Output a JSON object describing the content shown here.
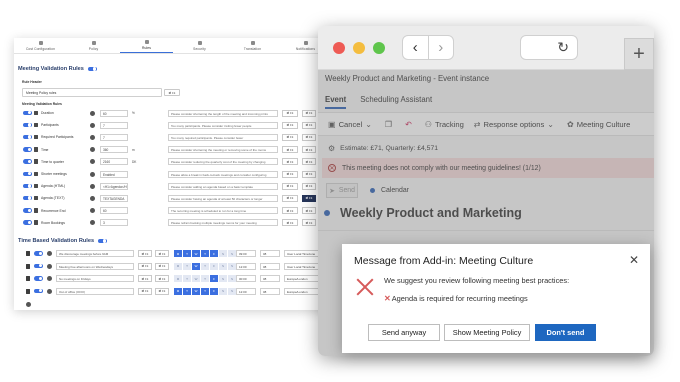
{
  "admin": {
    "nav_tabs": [
      "Cost Configuration",
      "Policy",
      "Rules",
      "Security",
      "Translation",
      "Notifications"
    ],
    "rules_section_title": "Meeting Validation Rules",
    "rule_header_label": "Rule Header",
    "rule_name_value": "Meeting Policy rules",
    "rules_header_btn": "⇄ Fit",
    "meeting_rules_label": "Meeting Validation Rules",
    "rules": [
      {
        "name": "Duration",
        "value": "60",
        "unit": "%",
        "message": "Please consider shortening the length of the meeting and incoming prints",
        "btn1": "⇄ Fit",
        "btn2": "⇄ Fit"
      },
      {
        "name": "Participants",
        "value": "7",
        "unit": "",
        "message": "Too many participants. Please consider inviting fewer people",
        "btn1": "⇄ Fit",
        "btn2": "⇄ Fit"
      },
      {
        "name": "Required Participants",
        "value": "7",
        "unit": "",
        "message": "Too many required participants. Please consider fewer",
        "btn1": "⇄ Fit",
        "btn2": "⇄ Fit"
      },
      {
        "name": "Time",
        "value": "360",
        "unit": "m",
        "message": "Please consider shortening the meeting or removing some of the rooms",
        "btn1": "⇄ Fit",
        "btn2": "⇄ Fit"
      },
      {
        "name": "Time to quarter",
        "value": "2160",
        "unit": "DK",
        "message": "Please consider reducing the quarterly cost of the meeting by changing",
        "btn1": "⇄ Fit",
        "btn2": "⇄ Fit"
      },
      {
        "name": "Shorter meetings",
        "value": "Enabled",
        "unit": "",
        "message": "Please allow a break in back-to-back meetings and consider configuring",
        "btn1": "⇄ Fit",
        "btn2": "⇄ Fit"
      },
      {
        "name": "Agenda (HTML)",
        "value": "<H1>Agenda</H1><p>Wh",
        "unit": "",
        "message": "Please consider adding an agenda based on a basic template",
        "btn1": "⇄ Fit",
        "btn2": "⇄ Fit"
      },
      {
        "name": "Agenda (TEXT)",
        "value": "TEXTAGENDA",
        "unit": "",
        "message": "Please consider having an agenda of at least 50 characters or longer",
        "btn1": "⇄ Fit",
        "btn2": "⇄ Fit",
        "dark": true
      },
      {
        "name": "Recurrence End",
        "value": "60",
        "unit": "",
        "message": "The recurring meeting is scheduled to run for a long time",
        "btn1": "⇄ Fit",
        "btn2": "⇄ Fit"
      },
      {
        "name": "Room Bookings",
        "value": "3",
        "unit": "",
        "message": "Please refrain booking multiple meetings rooms for your meeting",
        "btn1": "⇄ Fit",
        "btn2": "⇄ Fit"
      }
    ],
    "time_section_title": "Time Based Validation Rules",
    "time_rules": [
      {
        "message": "We discourage meetings before 9AM",
        "days": [
          true,
          true,
          true,
          true,
          true,
          false,
          false
        ],
        "from": "09:00",
        "to": "08",
        "tz": "User Local Timezone"
      },
      {
        "message": "Meeting free afternoons on Wednesdays",
        "days": [
          false,
          false,
          true,
          false,
          false,
          false,
          false
        ],
        "from": "12:00",
        "to": "08",
        "tz": "User Local Timezone"
      },
      {
        "message": "No meetings on Fridays",
        "days": [
          false,
          false,
          false,
          false,
          true,
          false,
          false
        ],
        "from": "00:00",
        "to": "08",
        "tz": "Europe/London"
      },
      {
        "message": "Out of office (OOO)",
        "days": [
          true,
          true,
          true,
          true,
          true,
          false,
          false
        ],
        "from": "12:00",
        "to": "08",
        "tz": "Europe/London"
      }
    ],
    "day_letters": [
      "M",
      "T",
      "W",
      "T",
      "F",
      "S",
      "S"
    ],
    "time_btn": "⇄ Fit"
  },
  "outlook": {
    "event_title": "Weekly Product and Marketing - Event instance",
    "tabs": [
      "Event",
      "Scheduling Assistant"
    ],
    "toolbar": {
      "cancel": "Cancel",
      "tracking": "Tracking",
      "response_options": "Response options",
      "meeting_culture": "Meeting Culture"
    },
    "estimate": "Estimate: £71, Quarterly: £4,571",
    "warning": "This meeting does not comply with our meeting guidelines! (1/12)",
    "send_label": "Send",
    "calendar_label": "Calendar",
    "subject": "Weekly Product and Marketing"
  },
  "dialog": {
    "title": "Message from Add-in: Meeting Culture",
    "message": "We suggest you review following meeting best practices:",
    "item": "Agenda is required for recurring meetings",
    "buttons": {
      "send_anyway": "Send anyway",
      "show_policy": "Show Meeting Policy",
      "dont_send": "Don't send"
    }
  },
  "colors": {
    "accent": "#1e67c0",
    "warning_bg": "#f6dada",
    "error_red": "#d65a5a"
  }
}
